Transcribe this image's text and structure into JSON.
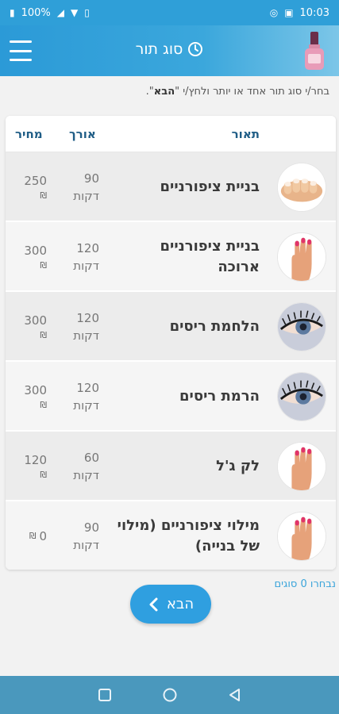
{
  "status": {
    "battery": "100%",
    "time": "10:03"
  },
  "app": {
    "title": "סוג תור",
    "title_icon": "clock-icon",
    "menu_icon": "hamburger-menu-icon",
    "logo_icon": "nail-polish-icon"
  },
  "instruction": {
    "prefix": "בחר/י סוג תור אחד או יותר ולחץ/י \"",
    "bold": "הבא",
    "suffix": "\"."
  },
  "table": {
    "headers": {
      "description": "תאור",
      "length": "אורך",
      "price": "מחיר"
    },
    "rows": [
      {
        "name": "בניית ציפורניים",
        "minutes": "90",
        "unit": "דקות",
        "price": "250",
        "currency": "₪",
        "image": "nails-manicure-photo"
      },
      {
        "name": "בניית ציפורניים ארוכה",
        "minutes": "120",
        "unit": "דקות",
        "price": "300",
        "currency": "₪",
        "image": "pink-nails-hand-photo"
      },
      {
        "name": "הלחמת ריסים",
        "minutes": "120",
        "unit": "דקות",
        "price": "300",
        "currency": "₪",
        "image": "eyelash-photo"
      },
      {
        "name": "הרמת ריסים",
        "minutes": "120",
        "unit": "דקות",
        "price": "300",
        "currency": "₪",
        "image": "eyelash-photo"
      },
      {
        "name": "לק ג'ל",
        "minutes": "60",
        "unit": "דקות",
        "price": "120",
        "currency": "₪",
        "image": "pink-nails-hand-photo"
      },
      {
        "name": "מילוי ציפורניים (מילוי של בנייה)",
        "minutes": "90",
        "unit": "דקות",
        "price": "0",
        "currency": "₪",
        "image": "pink-nails-hand-photo"
      }
    ]
  },
  "footer": {
    "selected_count": "נבחרו 0 סוגים",
    "next_label": "הבא",
    "next_icon": "chevron-left-icon"
  },
  "colors": {
    "primary": "#2f9fe0",
    "header_text": "#1f5d86",
    "link": "#3aa4da"
  }
}
